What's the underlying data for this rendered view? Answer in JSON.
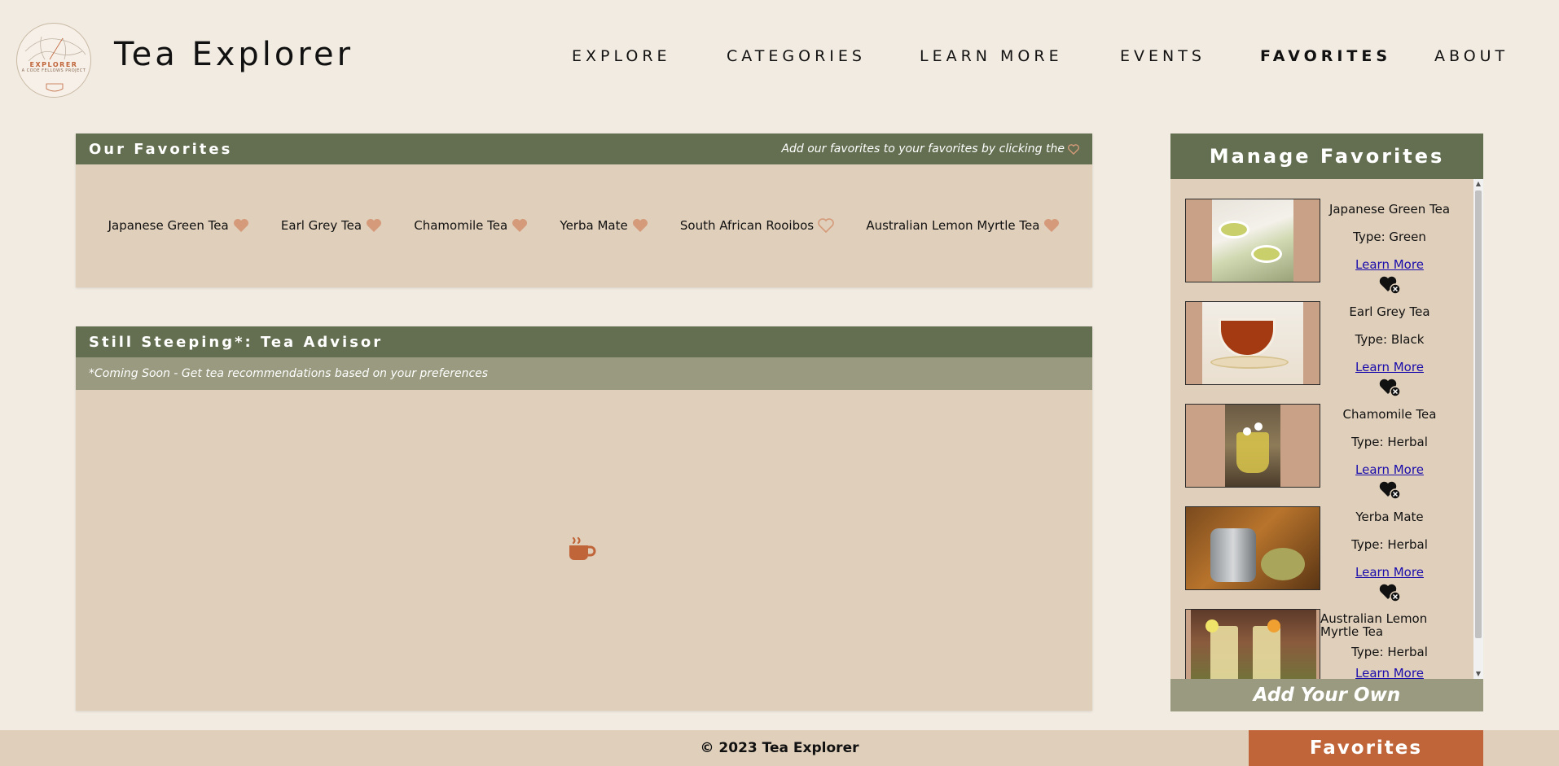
{
  "header": {
    "logo_text": "EXPLORER",
    "logo_sub": "A CODE FELLOWS PROJECT",
    "title": "Tea Explorer",
    "nav": [
      {
        "label": "EXPLORE",
        "active": false
      },
      {
        "label": "CATEGORIES",
        "active": false
      },
      {
        "label": "LEARN MORE",
        "active": false
      },
      {
        "label": "EVENTS",
        "active": false
      },
      {
        "label": "FAVORITES",
        "active": true
      },
      {
        "label": "ABOUT",
        "active": false
      }
    ]
  },
  "our_favorites": {
    "title": "Our Favorites",
    "hint": "Add our favorites to your favorites by clicking the",
    "items": [
      {
        "label": "Japanese Green Tea",
        "favorited": true
      },
      {
        "label": "Earl Grey Tea",
        "favorited": true
      },
      {
        "label": "Chamomile Tea",
        "favorited": true
      },
      {
        "label": "Yerba Mate",
        "favorited": true
      },
      {
        "label": "South African Rooibos",
        "favorited": false
      },
      {
        "label": "Australian Lemon Myrtle Tea",
        "favorited": true
      }
    ]
  },
  "advisor": {
    "title": "Still Steeping*: Tea Advisor",
    "subtitle": "*Coming Soon - Get tea recommendations based on your preferences",
    "icon": "mug-hot-icon"
  },
  "manage": {
    "title": "Manage Favorites",
    "items": [
      {
        "name": "Japanese Green Tea",
        "type": "Type: Green",
        "link": "Learn More",
        "image": "green-tea-cups-image"
      },
      {
        "name": "Earl Grey Tea",
        "type": "Type: Black",
        "link": "Learn More",
        "image": "earl-grey-teacup-image"
      },
      {
        "name": "Chamomile Tea",
        "type": "Type: Herbal",
        "link": "Learn More",
        "image": "chamomile-glass-image"
      },
      {
        "name": "Yerba Mate",
        "type": "Type: Herbal",
        "link": "Learn More",
        "image": "yerba-mate-gourd-image"
      },
      {
        "name": "Australian Lemon Myrtle Tea",
        "type": "Type: Herbal",
        "link": "Learn More",
        "image": "lemon-myrtle-glasses-image"
      }
    ],
    "add_own": "Add Your Own"
  },
  "footer": {
    "copyright": "© 2023 Tea Explorer",
    "favorites_tab": "Favorites"
  },
  "colors": {
    "background": "#f2ebe1",
    "panel": "#e0cfba",
    "header_green": "#636f50",
    "sub_green": "#999a7f",
    "accent": "#c0653a",
    "heart": "#d49a7a"
  }
}
